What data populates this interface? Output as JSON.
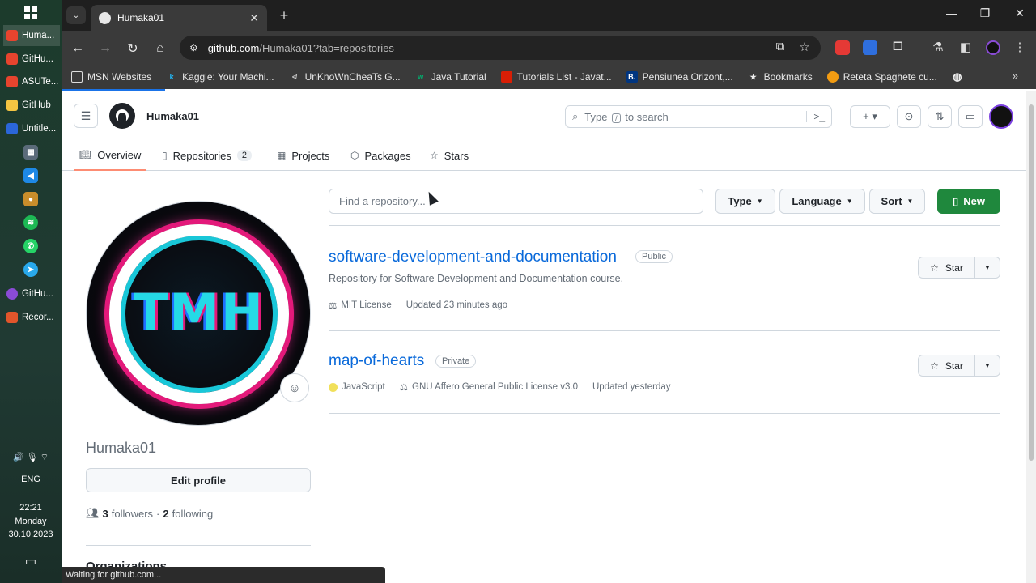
{
  "taskbar": {
    "items": [
      {
        "label": "Huma...",
        "color": "#e7442e"
      },
      {
        "label": "GitHu...",
        "color": "#e7442e"
      },
      {
        "label": "ASUTe...",
        "color": "#e7442e"
      },
      {
        "label": "GitHub",
        "color": "#f5c542"
      },
      {
        "label": "Untitle...",
        "color": "#2b66d9"
      }
    ],
    "apps": [
      {
        "icon": "calculator-icon",
        "color": "#5b6b7a"
      },
      {
        "icon": "vscode-icon",
        "color": "#1e88e5"
      },
      {
        "icon": "paint-icon",
        "color": "#c98d2b"
      },
      {
        "icon": "spotify-icon",
        "color": "#1db954"
      },
      {
        "icon": "whatsapp-icon",
        "color": "#25d366"
      },
      {
        "icon": "telegram-icon",
        "color": "#29a9eb"
      }
    ],
    "items2": [
      {
        "label": "GitHu...",
        "color": "#8a4bd6"
      },
      {
        "label": "Recor...",
        "color": "#e2552b"
      }
    ],
    "language": "ENG",
    "time": "22:21",
    "day": "Monday",
    "date": "30.10.2023"
  },
  "browser": {
    "tab_title": "Humaka01",
    "url_host": "github.com",
    "url_rest": "/Humaka01?tab=repositories",
    "bookmarks": [
      {
        "label": "MSN Websites",
        "color": "#e8e8e8",
        "icon": "folder-icon"
      },
      {
        "label": "Kaggle: Your Machi...",
        "color": "#20beff",
        "icon": "kaggle-icon"
      },
      {
        "label": "UnKnoWnCheaTs G...",
        "color": "#cccccc",
        "icon": "uc-icon"
      },
      {
        "label": "Java Tutorial",
        "color": "#04aa6d",
        "icon": "w3-icon"
      },
      {
        "label": "Tutorials List - Javat...",
        "color": "#d81e05",
        "icon": "javatpoint-icon"
      },
      {
        "label": "Pensiunea Orizont,...",
        "color": "#003580",
        "icon": "booking-icon"
      },
      {
        "label": "Bookmarks",
        "color": "#e8e8e8",
        "icon": "star-icon"
      },
      {
        "label": "Reteta Spaghete cu...",
        "color": "#f39c12",
        "icon": "recipe-icon"
      }
    ],
    "status": "Waiting for github.com..."
  },
  "header": {
    "username": "Humaka01",
    "search_placeholder_pre": "Type",
    "search_slash": "/",
    "search_placeholder_post": "to search"
  },
  "tabs": [
    {
      "label": "Overview",
      "icon": "book-icon"
    },
    {
      "label": "Repositories",
      "icon": "repo-icon",
      "count": "2"
    },
    {
      "label": "Projects",
      "icon": "table-icon"
    },
    {
      "label": "Packages",
      "icon": "package-icon"
    },
    {
      "label": "Stars",
      "icon": "star-icon"
    }
  ],
  "profile": {
    "avatar_text": "TMH",
    "display_name": "Humaka01",
    "edit_label": "Edit profile",
    "followers_count": "3",
    "followers_label": "followers",
    "separator": "·",
    "following_count": "2",
    "following_label": "following",
    "orgs_title": "Organizations"
  },
  "filters": {
    "find_placeholder": "Find a repository...",
    "type_label": "Type",
    "language_label": "Language",
    "sort_label": "Sort",
    "new_label": "New"
  },
  "repos": [
    {
      "name": "software-development-and-documentation",
      "visibility": "Public",
      "description": "Repository for Software Development and Documentation course.",
      "license": "MIT License",
      "updated": "Updated 23 minutes ago",
      "star_label": "Star"
    },
    {
      "name": "map-of-hearts",
      "visibility": "Private",
      "language": "JavaScript",
      "language_color": "#f1e05a",
      "license": "GNU Affero General Public License v3.0",
      "updated": "Updated yesterday",
      "star_label": "Star"
    }
  ]
}
